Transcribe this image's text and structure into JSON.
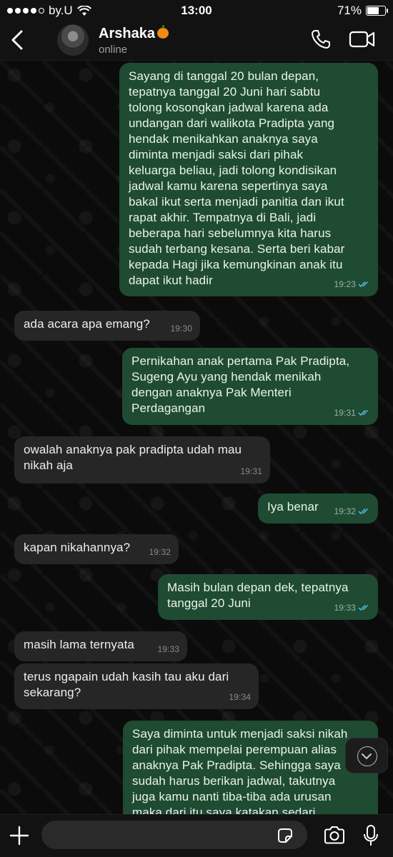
{
  "status_bar": {
    "carrier": "by.U",
    "time": "13:00",
    "battery": "71%",
    "battery_level": 0.71,
    "signal_bars": 4
  },
  "header": {
    "contact_name": "Arshaka",
    "status": "online"
  },
  "messages": [
    {
      "direction": "out",
      "text": "Sayang di tanggal 20 bulan depan,\ntepatnya tanggal 20 Juni hari sabtu\ntolong kosongkan jadwal karena ada\nundangan dari walikota Pradipta yang\nhendak menikahkan anaknya saya\ndiminta menjadi saksi dari pihak\nkeluarga beliau, jadi tolong kondisikan\njadwal kamu karena sepertinya saya\nbakal ikut serta menjadi panitia dan ikut\nrapat akhir. Tempatnya di Bali, jadi\nbeberapa hari sebelumnya kita harus\nsudah terbang kesana. Serta beri kabar\nkepada Hagi jika kemungkinan anak itu\ndapat ikut hadir",
      "time": "19:23",
      "read": true
    },
    {
      "direction": "in",
      "text": "ada acara apa emang?",
      "time": "19:30"
    },
    {
      "direction": "out",
      "text": "Pernikahan anak pertama Pak Pradipta,\nSugeng Ayu yang hendak menikah\ndengan anaknya Pak Menteri\nPerdagangan",
      "time": "19:31",
      "read": true
    },
    {
      "direction": "in",
      "text": "owalah anaknya pak pradipta udah mau\nnikah aja",
      "time": "19:31"
    },
    {
      "direction": "out",
      "text": "Iya benar",
      "time": "19:32",
      "read": true
    },
    {
      "direction": "in",
      "text": "kapan nikahannya?",
      "time": "19:32"
    },
    {
      "direction": "out",
      "text": "Masih bulan depan dek, tepatnya\ntanggal 20 Juni",
      "time": "19:33",
      "read": true
    },
    {
      "direction": "in",
      "text": "masih lama ternyata",
      "time": "19:33"
    },
    {
      "direction": "in",
      "text": "terus ngapain udah kasih tau aku dari\nsekarang?",
      "time": "19:34"
    },
    {
      "direction": "out",
      "text": "Saya diminta untuk menjadi saksi nikah\ndari pihak mempelai perempuan alias\nanaknya Pak Pradipta. Sehingga saya\nsudah harus berikan jadwal, takutnya\njuga kamu nanti tiba-tiba ada urusan\nmaka dari itu saya katakan sedari",
      "time": ""
    }
  ],
  "composer": {
    "placeholder": "",
    "value": ""
  },
  "icons": {
    "back": "chevron-left-icon",
    "call": "phone-icon",
    "video": "video-camera-icon",
    "add": "plus-icon",
    "sticker": "sticker-icon",
    "camera": "camera-icon",
    "mic": "microphone-icon",
    "scroll": "chevron-down-icon"
  },
  "colors": {
    "outgoing_bubble": "#1f4b33",
    "incoming_bubble": "#262626",
    "read_ticks": "#53bdeb",
    "background": "#0b0b0b"
  }
}
